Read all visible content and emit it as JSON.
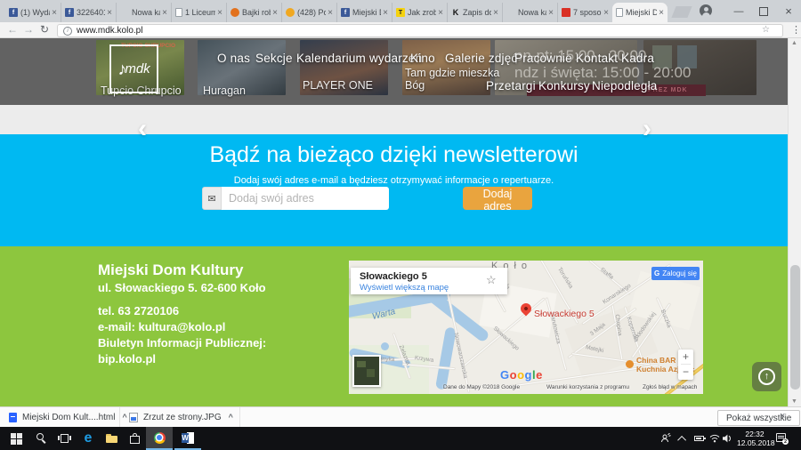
{
  "icons": {
    "close": "×",
    "back": "←",
    "forward": "→",
    "reload": "↻",
    "star": "☆",
    "menu": "⋮",
    "info": "i",
    "envelope": "✉",
    "up_arrow": "↑",
    "chev_left": "‹",
    "chev_right": "›",
    "scroll_up": "▲",
    "scroll_down": "▼",
    "minimize": "—",
    "caret": "^",
    "note": "♪",
    "edge": "e",
    "word": "W",
    "google_g": "G",
    "plus": "+",
    "minus": "−"
  },
  "browser": {
    "url": "www.mdk.kolo.pl",
    "tabs": [
      {
        "title": "(1) Wyda",
        "letter": "f"
      },
      {
        "title": "3226401",
        "letter": "f"
      },
      {
        "title": "Nowa karta",
        "letter": ""
      },
      {
        "title": "1 Liceum",
        "letter": ""
      },
      {
        "title": "Bajki rob",
        "letter": ""
      },
      {
        "title": "(428) Po",
        "letter": ""
      },
      {
        "title": "Miejski D",
        "letter": "f"
      },
      {
        "title": "Jak zrob",
        "letter": "T"
      },
      {
        "title": "Zapis do",
        "letter": "K"
      },
      {
        "title": "Nowa karta",
        "letter": ""
      },
      {
        "title": "7 sposo",
        "letter": ""
      },
      {
        "title": "Miejski D",
        "letter": ""
      }
    ]
  },
  "site": {
    "logo": "mdk",
    "nav1": [
      "O nas",
      "Sekcje",
      "Kalendarium wydarzeń",
      "Kino",
      "Galerie zdjęć",
      "Pracownie",
      "Kontakt",
      "Kadra"
    ],
    "nav2": [
      "Przetargi",
      "Konkursy",
      "Niepodległa"
    ],
    "slides": {
      "top1": "TUPCIO CHRUPCIO",
      "caption1": "Tupcio Chrupcio",
      "caption2": "Huragan",
      "caption3": "PLAYER ONE",
      "caption4a": "Tam gdzie mieszka",
      "caption4b": "Bóg",
      "hours1": "pn-pt: 15:00 - 20:00",
      "hours2": "ndz i święta: 15:00 - 20:00",
      "banner": "PREZ MDK"
    }
  },
  "newsletter": {
    "title": "Bądź na bieżąco dzięki newsletterowi",
    "subtitle": "Dodaj swój adres e-mail a będziesz otrzymywać informacje o repertuarze.",
    "placeholder": "Dodaj swój adres",
    "button": "Dodaj adres"
  },
  "footer": {
    "org": "Miejski Dom Kultury",
    "street": "ul. Słowackiego 5. 62-600 Koło",
    "phone": "tel. 63 2720106",
    "email": "e-mail: kultura@kolo.pl",
    "bip_label": "Biuletyn Informacji Publicznej:",
    "bip_url": "bip.kolo.pl"
  },
  "map": {
    "info_title": "Słowackiego 5",
    "info_link": "Wyświetl większą mapę",
    "login": "Zaloguj się",
    "city": "Koło",
    "river": "Warta",
    "marker_label": "Słowackiego 5",
    "streets": [
      "Mała",
      "Toruńska",
      "Staffa",
      "Konarskiego",
      "Narutowicza",
      "Chopina",
      "Kopernika",
      "Buczka",
      "3 Maja",
      "Matejki",
      "Skłodowskiej",
      "Słowackiego",
      "Nowowarszawska",
      "Zelazna",
      "Krzywa",
      "Asnyka"
    ],
    "poi1": "China BAR",
    "poi2": "Kuchnia Azjatyc",
    "google": [
      "G",
      "o",
      "o",
      "g",
      "l",
      "e"
    ],
    "attr1": "Dane do Mapy ©2018 Google",
    "attr2": "Warunki korzystania z programu",
    "attr3": "Zgłoś błąd w mapach"
  },
  "downloads": {
    "file1": "Miejski Dom Kult....html",
    "file2": "Zrzut ze strony.JPG",
    "show_all": "Pokaż wszystkie"
  },
  "taskbar": {
    "time": "22:32",
    "date": "12.05.2018",
    "badge": "2"
  }
}
